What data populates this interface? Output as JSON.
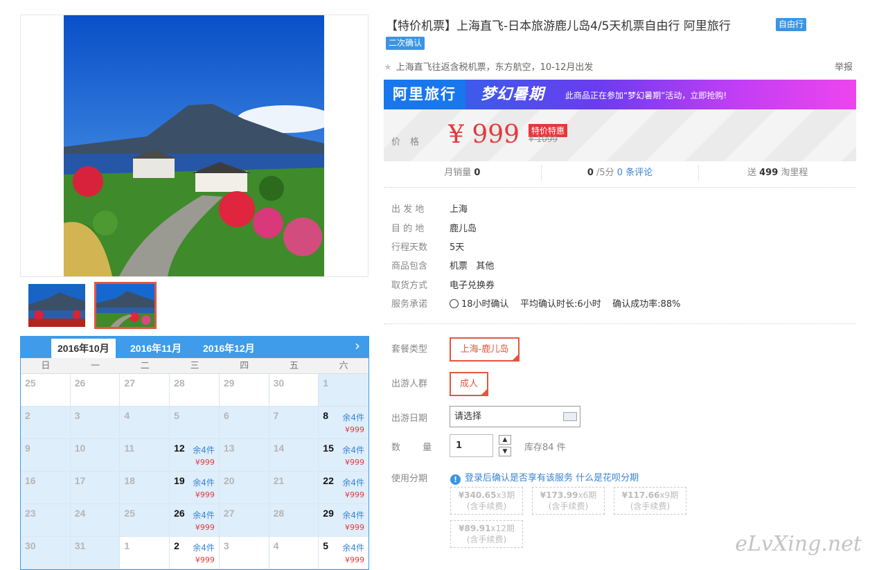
{
  "product": {
    "title": "【特价机票】上海直飞-日本旅游鹿儿岛4/5天机票自由行 阿里旅行",
    "badge_free": "自由行",
    "badge_confirm": "二次确认",
    "subtitle": "上海直飞往返含税机票，东方航空，10-12月出发",
    "report": "举报"
  },
  "banner": {
    "brand": "阿里旅行",
    "promo": "梦幻暑期",
    "note": "此商品正在参加“梦幻暑期”活动，立即抢购!"
  },
  "price": {
    "label": "价格",
    "currency": "¥",
    "value": "999",
    "tag": "特价特惠",
    "original": "¥ 1099"
  },
  "stats": {
    "monthly_sales_label": "月销量",
    "monthly_sales": "0",
    "rating": "0",
    "rating_suffix": "/5分",
    "reviews": "0 条评论",
    "points_prefix": "送",
    "points": "499",
    "points_suffix": "淘里程"
  },
  "info": [
    {
      "key": "出 发 地",
      "value": "上海"
    },
    {
      "key": "目 的 地",
      "value": "鹿儿岛"
    },
    {
      "key": "行程天数",
      "value": "5天"
    },
    {
      "key": "商品包含",
      "value": "机票   其他"
    },
    {
      "key": "取货方式",
      "value": "电子兑换券"
    },
    {
      "key": "服务承诺",
      "value": "18小时确认    平均确认时长:6小时    确认成功率:88%"
    }
  ],
  "options": {
    "package_label": "套餐类型",
    "package_value": "上海-鹿儿岛",
    "travelers_label": "出游人群",
    "travelers_value": "成人",
    "date_label": "出游日期",
    "date_value": "请选择",
    "qty_label": "数 量",
    "qty_value": "1",
    "stock": "库存84 件",
    "installment_label": "使用分期",
    "installment_login": "登录后确认是否享有该服务",
    "installment_link": "什么是花呗分期"
  },
  "installments": [
    {
      "amount": "¥340.65",
      "periods": "x3期",
      "fee": "(含手续费)"
    },
    {
      "amount": "¥173.99",
      "periods": "x6期",
      "fee": "(含手续费)"
    },
    {
      "amount": "¥117.66",
      "periods": "x9期",
      "fee": "(含手续费)"
    },
    {
      "amount": "¥89.91",
      "periods": "x12期",
      "fee": "(含手续费)"
    }
  ],
  "calendar": {
    "tabs": [
      "2016年10月",
      "2016年11月",
      "2016年12月"
    ],
    "weekdays": [
      "日",
      "一",
      "二",
      "三",
      "四",
      "五",
      "六"
    ],
    "cells": [
      {
        "day": "25",
        "white": true
      },
      {
        "day": "26",
        "white": true
      },
      {
        "day": "27",
        "white": true
      },
      {
        "day": "28",
        "white": true
      },
      {
        "day": "29",
        "white": true
      },
      {
        "day": "30",
        "white": true
      },
      {
        "day": "1"
      },
      {
        "day": "2"
      },
      {
        "day": "3"
      },
      {
        "day": "4"
      },
      {
        "day": "5"
      },
      {
        "day": "6"
      },
      {
        "day": "7"
      },
      {
        "day": "8",
        "stock": "余4件",
        "price": "¥999"
      },
      {
        "day": "9"
      },
      {
        "day": "10"
      },
      {
        "day": "11"
      },
      {
        "day": "12",
        "stock": "余4件",
        "price": "¥999"
      },
      {
        "day": "13"
      },
      {
        "day": "14"
      },
      {
        "day": "15",
        "stock": "余4件",
        "price": "¥999"
      },
      {
        "day": "16"
      },
      {
        "day": "17"
      },
      {
        "day": "18"
      },
      {
        "day": "19",
        "stock": "余4件",
        "price": "¥999"
      },
      {
        "day": "20"
      },
      {
        "day": "21"
      },
      {
        "day": "22",
        "stock": "余4件",
        "price": "¥999"
      },
      {
        "day": "23"
      },
      {
        "day": "24"
      },
      {
        "day": "25"
      },
      {
        "day": "26",
        "stock": "余4件",
        "price": "¥999"
      },
      {
        "day": "27"
      },
      {
        "day": "28"
      },
      {
        "day": "29",
        "stock": "余4件",
        "price": "¥999"
      },
      {
        "day": "30"
      },
      {
        "day": "31"
      },
      {
        "day": "1",
        "white": true
      },
      {
        "day": "2",
        "white": true,
        "stock": "余4件",
        "price": "¥999"
      },
      {
        "day": "3",
        "white": true
      },
      {
        "day": "4",
        "white": true
      },
      {
        "day": "5",
        "white": true,
        "stock": "余4件",
        "price": "¥999"
      }
    ],
    "next_icon": "chevron-right-icon"
  },
  "watermark": "eLvXing.net",
  "colors": {
    "accent": "#3b95e2",
    "price": "#e4393c",
    "selected": "#e4553f"
  }
}
